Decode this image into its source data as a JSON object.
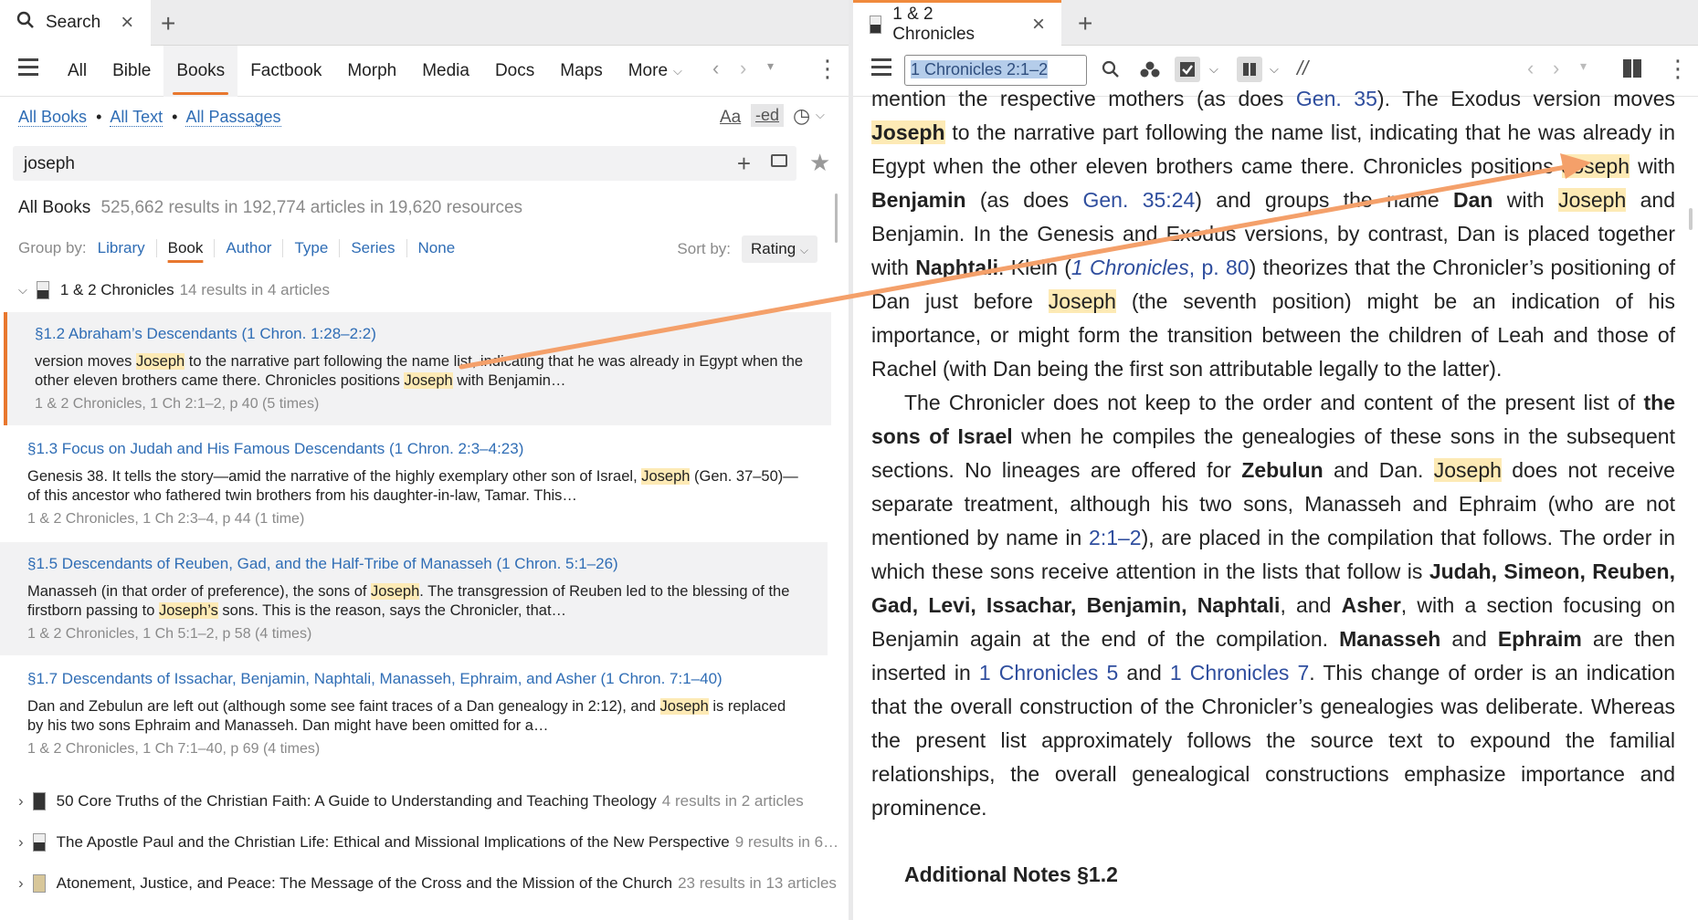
{
  "left": {
    "tab": {
      "title": "Search"
    },
    "nav": {
      "items": [
        "All",
        "Bible",
        "Books",
        "Factbook",
        "Morph",
        "Media",
        "Docs",
        "Maps",
        "More"
      ],
      "active": "Books"
    },
    "links": {
      "all_books": "All Books",
      "all_text": "All Text",
      "all_passages": "All Passages",
      "sep": "•"
    },
    "case_label": "Aa",
    "ed_label": "-ed",
    "search": {
      "value": "joseph"
    },
    "results": {
      "label": "All Books",
      "summary": "525,662 results in 192,774 articles in 19,620 resources"
    },
    "groupby": {
      "label": "Group by:",
      "options": [
        "Library",
        "Book",
        "Author",
        "Type",
        "Series",
        "None"
      ],
      "active": "Book"
    },
    "sortby": {
      "label": "Sort by:",
      "value": "Rating"
    },
    "resource": {
      "title": "1 & 2 Chronicles",
      "count": "14 results in 4 articles"
    },
    "hits": [
      {
        "title": "§1.2 Abraham’s Descendants (1 Chron. 1:28–2:2)",
        "pre": "version moves ",
        "m1": "Joseph",
        "mid": " to the narrative part following the name list, indicating that he was already in Egypt when the other eleven brothers came there. Chronicles positions ",
        "m2": "Joseph",
        "post": " with Benjamin…",
        "meta": "1 & 2 Chronicles, 1 Ch 2:1–2, p 40 (5 times)"
      },
      {
        "title": "§1.3 Focus on Judah and His Famous Descendants (1 Chron. 2:3–4:23)",
        "pre": "Genesis 38. It tells the story—amid the narrative of the highly exemplary other son of Israel, ",
        "m1": "Joseph",
        "mid": " (Gen. 37–50)—of this ancestor who fathered twin brothers from his daughter-in-law, Tamar. This…",
        "m2": "",
        "post": "",
        "meta": "1 & 2 Chronicles, 1 Ch 2:3–4, p 44 (1 time)"
      },
      {
        "title": "§1.5 Descendants of Reuben, Gad, and the Half-Tribe of Manasseh (1 Chron. 5:1–26)",
        "pre": "Manasseh (in that order of preference), the sons of ",
        "m1": "Joseph",
        "mid": ". The transgression of Reuben led to the blessing of the firstborn passing to ",
        "m2": "Joseph’s",
        "post": " sons. This is the reason, says the Chronicler, that…",
        "meta": "1 & 2 Chronicles, 1 Ch 5:1–2, p 58 (4 times)"
      },
      {
        "title": "§1.7 Descendants of Issachar, Benjamin, Naphtali, Manasseh, Ephraim, and Asher (1 Chron. 7:1–40)",
        "pre": "Dan and Zebulun are left out (although some see faint traces of a Dan genealogy in 2:12), and ",
        "m1": "Joseph",
        "mid": " is replaced by his two sons Ephraim and Manasseh. Dan might have been omitted for a…",
        "m2": "",
        "post": "",
        "meta": "1 & 2 Chronicles, 1 Ch 7:1–40, p 69 (4 times)"
      }
    ],
    "collapsed": [
      {
        "title": "50 Core Truths of the Christian Faith: A Guide to Understanding and Teaching Theology",
        "count": "4 results in 2 articles"
      },
      {
        "title": "The Apostle Paul and the Christian Life: Ethical and Missional Implications of the New Perspective",
        "count": "9 results in 6…"
      },
      {
        "title": "Atonement, Justice, and Peace: The Message of the Cross and the Mission of the Church",
        "count": "23 results in 13 articles"
      }
    ]
  },
  "right": {
    "tab": {
      "title": "1 & 2 Chronicles"
    },
    "reference": "1 Chronicles 2:1–2",
    "parallel_label": "//",
    "reader": {
      "p1": {
        "a": "mention the respective mothers (as does ",
        "gen35": "Gen. 35",
        "b": "). The Exodus version moves ",
        "j1": "Joseph",
        "c": " to the narrative part following the name list, indicating that he was already in Egypt when the other eleven brothers came there. Chronicles positions ",
        "j2": "Joseph",
        "d": " with ",
        "benjamin": "Benjamin",
        "e": " (as does ",
        "gen3524": "Gen. 35:24",
        "f": ") and groups the name ",
        "dan": "Dan",
        "g": " with ",
        "j3": "Joseph",
        "h": " and Benjamin. In the Genesis and Exodus versions, by contrast, Dan is placed together with ",
        "naphtali": "Naphtali",
        "i": ". Klein (",
        "klein_title": "1 Chronicles",
        "j": ", ",
        "klein_page": "p. 80",
        "k": ") theorizes that the Chronicler’s positioning of Dan just before ",
        "j4": "Joseph",
        "l": " (the seventh position) might be an indication of his importance, or might form the transition between the children of Leah and those of Rachel (with Dan being the first son attributable legally to the latter)."
      },
      "p2": {
        "a": "The Chronicler does not keep to the order and content of the present list of ",
        "sons": "the sons of Israel",
        "b": " when he compiles the genealogies of these sons in the subsequent sections. No lineages are offered for ",
        "zebulun": "Zebulun",
        "c": " and Dan. ",
        "j5": "Joseph",
        "d": " does not receive separate treatment, although his two sons, Manasseh and Ephraim (who are not mentioned by name in ",
        "ref212": "2:1–2",
        "e": "), are placed in the compilation that follows. The order in which these sons receive attention in the lists that follow is ",
        "order": "Judah, Simeon, Reuben, Gad, Levi, Issachar, Benjamin, Naphtali",
        "f": ", and ",
        "asher": "Asher",
        "g": ", with a section focusing on Benjamin again at the end of the compilation. ",
        "manasseh": "Manasseh",
        "h": " and ",
        "ephraim": "Ephraim",
        "i": " are then inserted in ",
        "ch5": "1 Chronicles 5",
        "j": " and ",
        "ch7": "1 Chronicles 7",
        "k": ". This change of order is an indication that the overall construction of the Chronicler’s genealogies was delib­erate. Whereas the present list approximately follows the source text to expound the familial relationships, the overall genealogical constructions emphasize impor­tance and prominence."
      },
      "notes_heading": "Additional Notes §1.2"
    }
  },
  "colors": {
    "accent": "#e8772e",
    "link": "#2f6db5",
    "highlight": "#fdeab5",
    "arrow": "#f4a06a"
  }
}
